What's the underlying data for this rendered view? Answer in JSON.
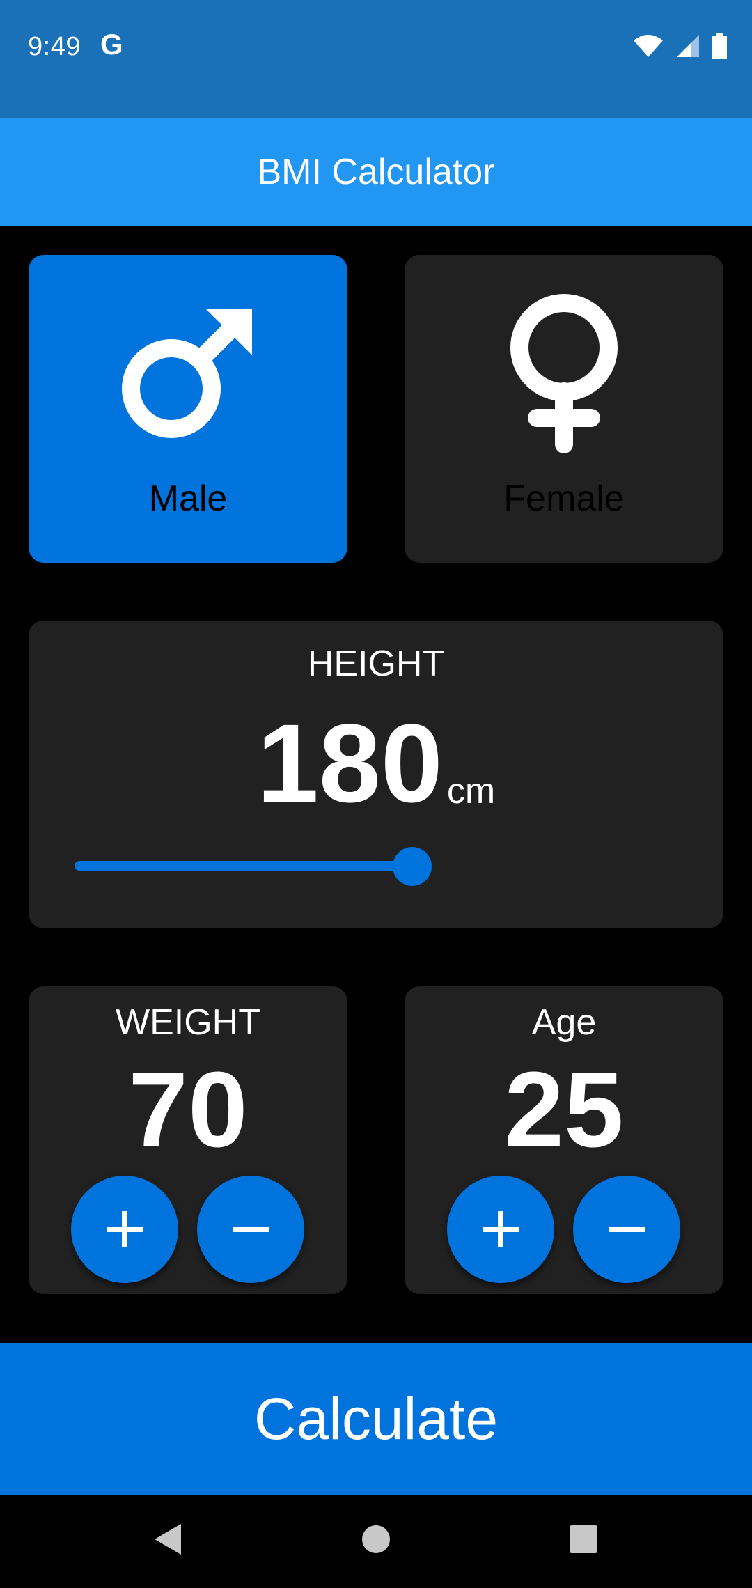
{
  "status_bar": {
    "time": "9:49",
    "google_icon_text": "G",
    "icons": [
      "wifi-icon",
      "signal-icon",
      "battery-icon"
    ]
  },
  "app_bar": {
    "title": "BMI Calculator"
  },
  "gender": {
    "male": {
      "label": "Male",
      "selected": true,
      "icon": "male-symbol-icon"
    },
    "female": {
      "label": "Female",
      "selected": false,
      "icon": "female-symbol-icon"
    }
  },
  "height": {
    "title": "HEIGHT",
    "value": "180",
    "unit": "cm",
    "slider_fraction": 0.56
  },
  "weight": {
    "title": "WEIGHT",
    "value": "70",
    "plus_icon": "plus-icon",
    "minus_icon": "minus-icon"
  },
  "age": {
    "title": "Age",
    "value": "25",
    "plus_icon": "plus-icon",
    "minus_icon": "minus-icon"
  },
  "calculate": {
    "label": "Calculate"
  },
  "nav": {
    "icons": [
      "back-icon",
      "home-icon",
      "recents-icon"
    ]
  },
  "colors": {
    "status_bar": "#1b71b8",
    "app_bar": "#2296f3",
    "accent": "#0073dd",
    "card": "#212121",
    "background": "#000000"
  }
}
